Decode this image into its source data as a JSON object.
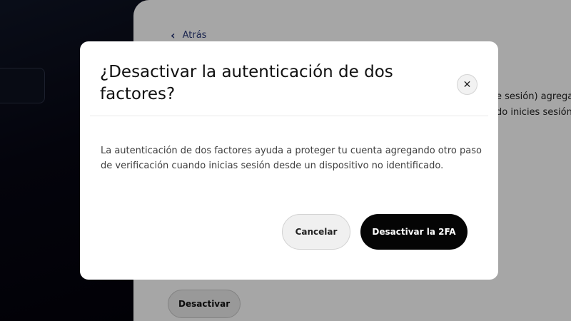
{
  "background": {
    "back_label": "Atrás",
    "back_icon": "chevron-left-icon",
    "text_fragment_1": "e sesión) agrega",
    "text_fragment_2": "do inicies sesión",
    "deactivate_label": "Desactivar"
  },
  "modal": {
    "title": "¿Desactivar la autenticación de dos factores?",
    "close_icon": "close-icon",
    "close_glyph": "✕",
    "body": "La autenticación de dos factores ayuda a proteger tu cuenta agregando otro paso de verificación cuando inicias sesión desde un dispositivo no identificado.",
    "cancel_label": "Cancelar",
    "confirm_label": "Desactivar la 2FA"
  },
  "colors": {
    "overlay": "rgba(0,0,0,0.35)",
    "primary_button": "#050505",
    "secondary_button": "#f0f0f0",
    "link": "#2a3a7a"
  }
}
